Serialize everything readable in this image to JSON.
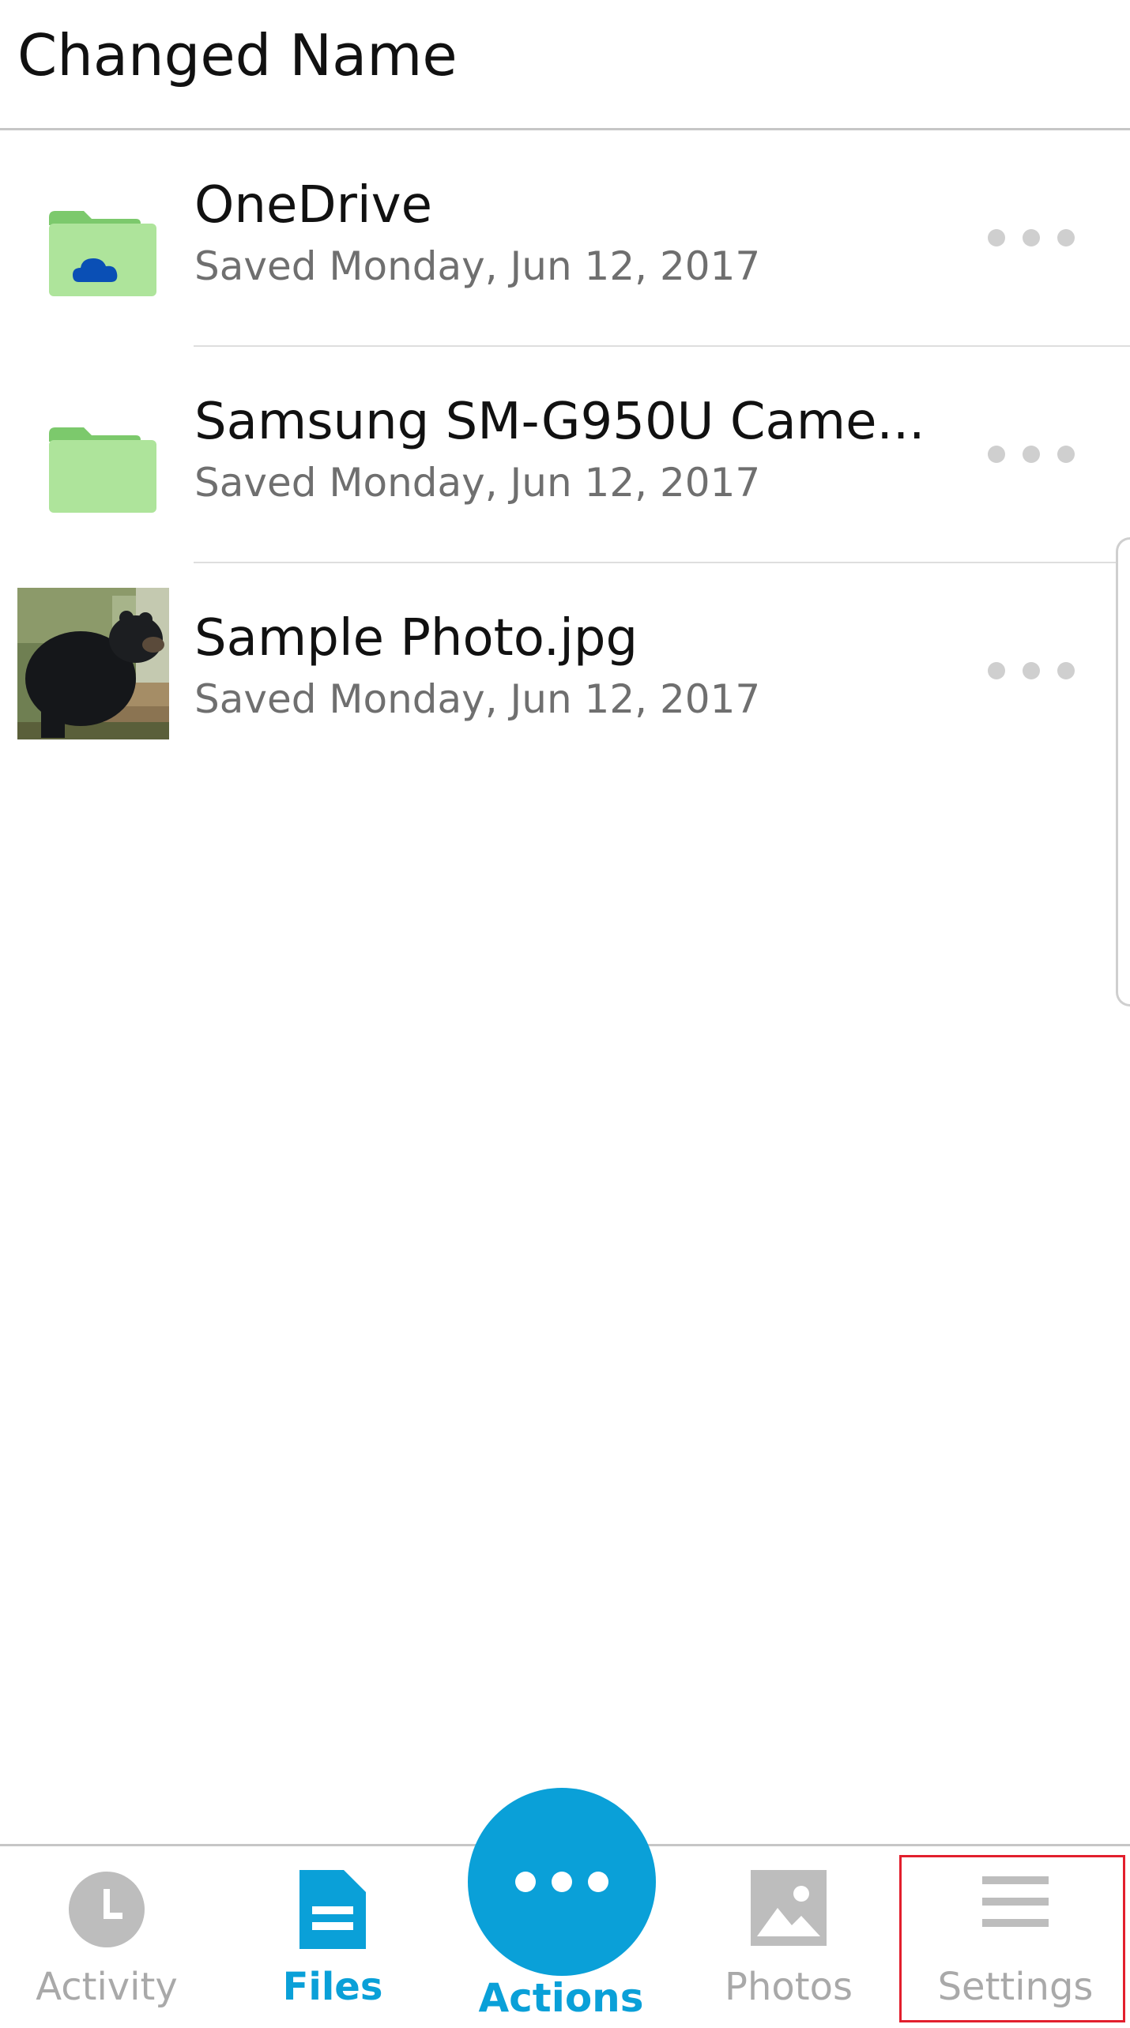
{
  "header": {
    "title": "Changed Name"
  },
  "files": [
    {
      "name": "OneDrive",
      "subtitle": "Saved Monday, Jun 12, 2017",
      "icon": "onedrive-folder-icon"
    },
    {
      "name": "Samsung SM-G950U Came...",
      "subtitle": "Saved Monday, Jun 12, 2017",
      "icon": "folder-icon"
    },
    {
      "name": "Sample Photo.jpg",
      "subtitle": "Saved Monday, Jun 12, 2017",
      "icon": "photo-thumbnail"
    }
  ],
  "bottom_nav": {
    "activity": "Activity",
    "files": "Files",
    "actions": "Actions",
    "photos": "Photos",
    "settings": "Settings"
  },
  "colors": {
    "accent": "#0aa0d8",
    "folder": "#aee49b",
    "highlight": "#e21f2d"
  }
}
